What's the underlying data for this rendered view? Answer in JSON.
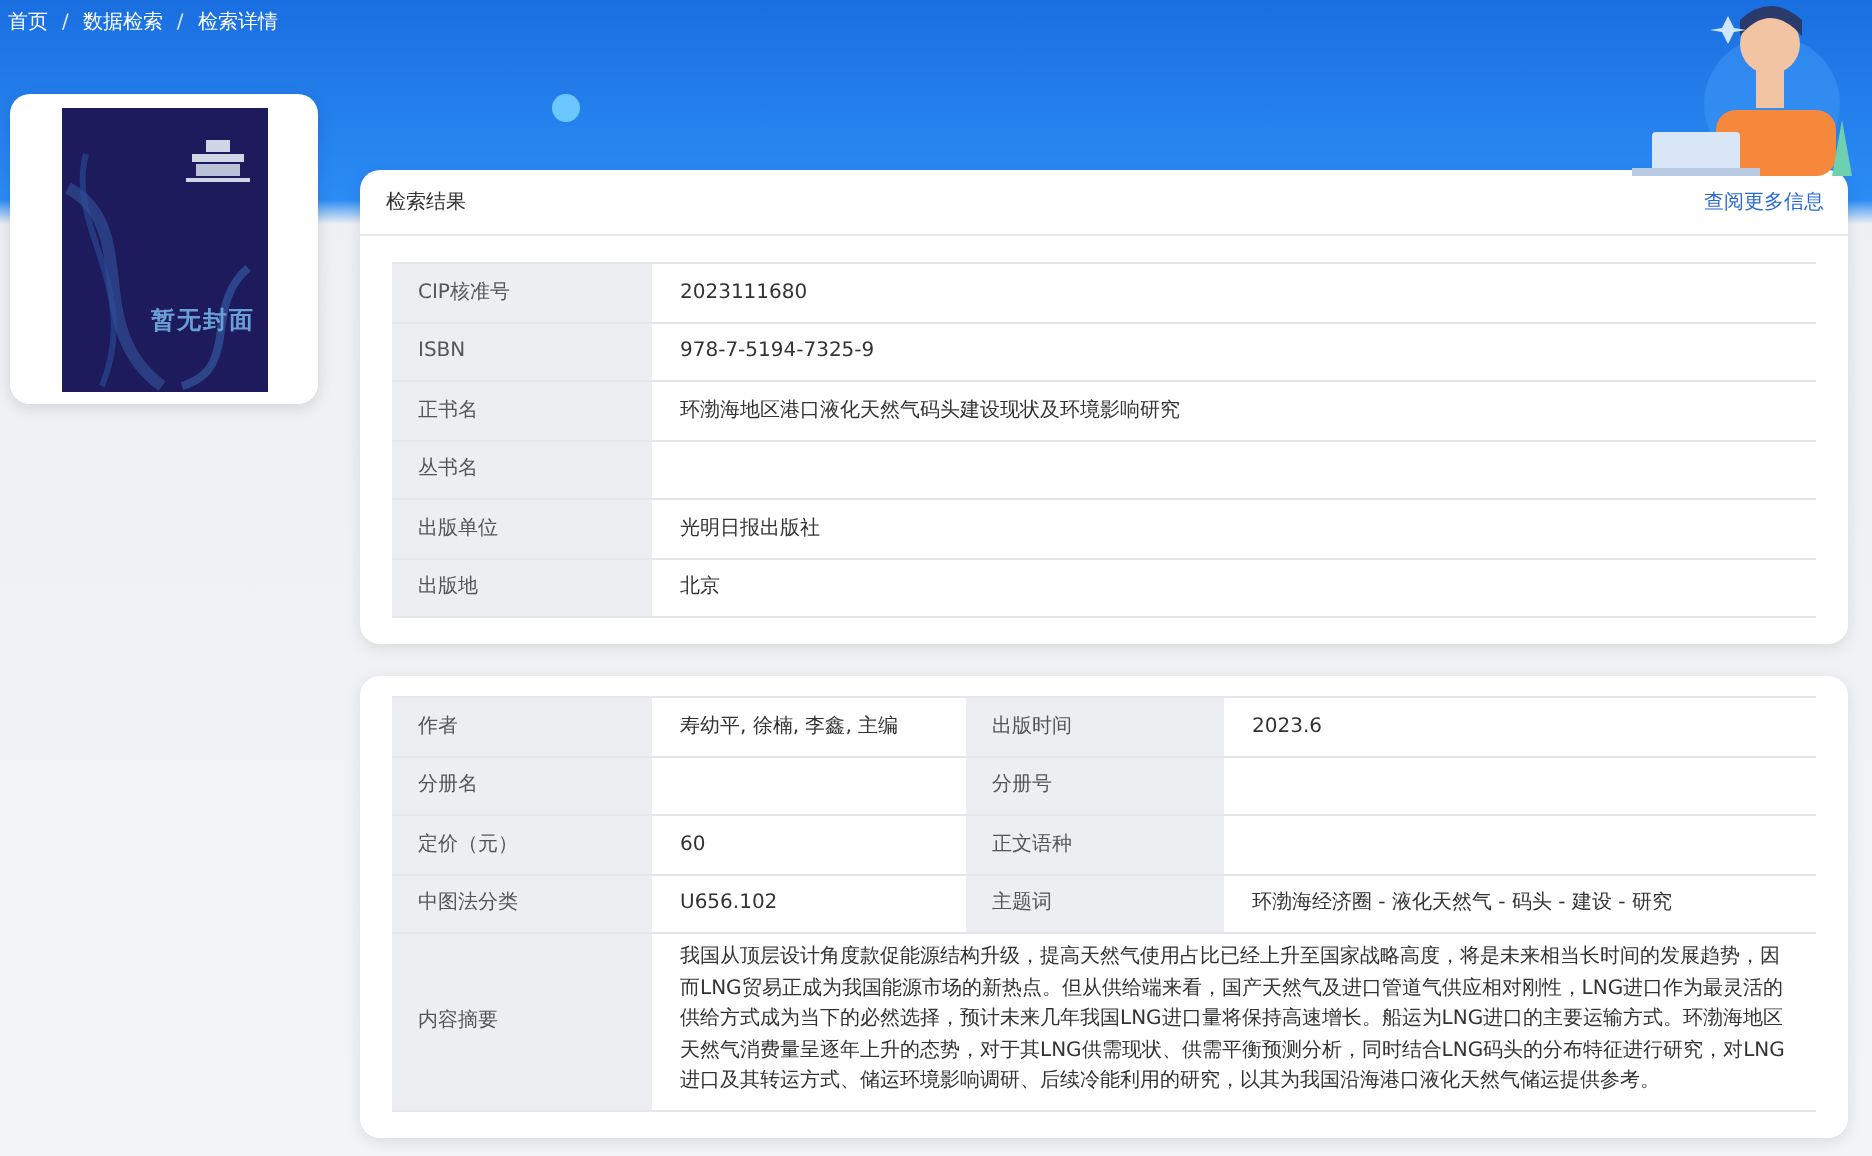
{
  "breadcrumb": [
    {
      "kind": "link",
      "label": "首页"
    },
    {
      "kind": "separator",
      "label": "/"
    },
    {
      "kind": "link",
      "label": "数据检索"
    },
    {
      "kind": "separator",
      "label": "/"
    },
    {
      "kind": "link",
      "label": "检索详情"
    }
  ],
  "cover": {
    "text": "暂无封面"
  },
  "result_card": {
    "title": "检索结果",
    "more_link": "查阅更多信息",
    "fields": [
      {
        "label": "CIP核准号",
        "value": "2023111680"
      },
      {
        "label": "ISBN",
        "value": "978-7-5194-7325-9"
      },
      {
        "label": "正书名",
        "value": "环渤海地区港口液化天然气码头建设现状及环境影响研究"
      },
      {
        "label": "丛书名"
      },
      {
        "label": "出版单位",
        "value": "光明日报出版社"
      },
      {
        "label": "出版地",
        "value": "北京"
      }
    ]
  },
  "detail_card": {
    "fields": [
      {
        "label": "作者",
        "value": "寿幼平, 徐楠, 李鑫, 主编"
      },
      {
        "label": "出版时间",
        "value": "2023.6"
      },
      {
        "label": "分册名"
      },
      {
        "label": "分册号"
      },
      {
        "label": "定价（元）",
        "value": "60"
      },
      {
        "label": "正文语种"
      },
      {
        "label": "中图法分类",
        "value": "U656.102"
      },
      {
        "label": "主题词",
        "value": "环渤海经济圈 - 液化天然气 - 码头 - 建设 - 研究"
      }
    ],
    "abstract": {
      "label": "内容摘要",
      "value": "我国从顶层设计角度款促能源结构升级，提高天然气使用占比已经上升至国家战略高度，将是未来相当长时间的发展趋势，因而LNG贸易正成为我国能源市场的新热点。但从供给端来看，国产天然气及进口管道气供应相对刚性，LNG进口作为最灵活的供给方式成为当下的必然选择，预计未来几年我国LNG进口量将保持高速增长。船运为LNG进口的主要运输方式。环渤海地区天然气消费量呈逐年上升的态势，对于其LNG供需现状、供需平衡预测分析，同时结合LNG码头的分布特征进行研究，对LNG进口及其转运方式、储运环境影响调研、后续冷能利用的研究，以其为我国沿海港口液化天然气储运提供参考。"
    }
  }
}
